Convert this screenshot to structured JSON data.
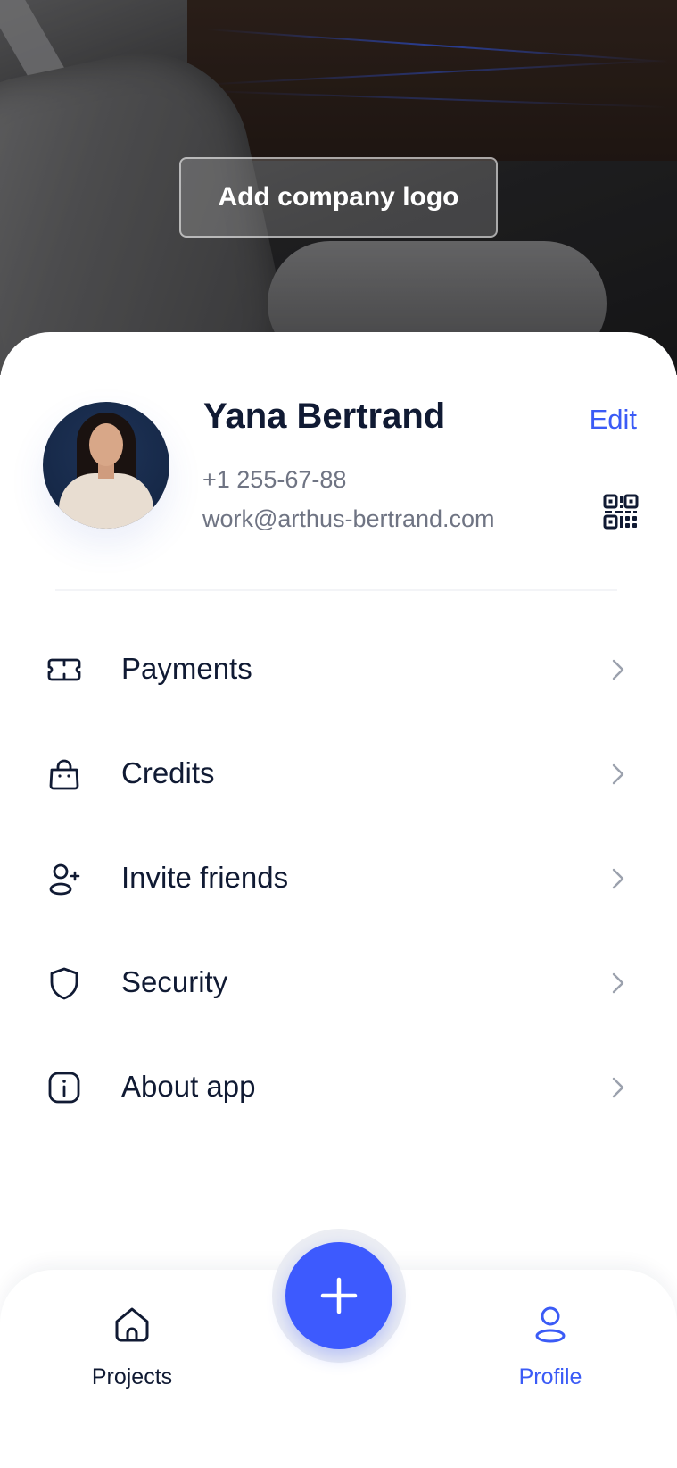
{
  "cover": {
    "add_logo_label": "Add company logo"
  },
  "profile": {
    "name": "Yana Bertrand",
    "edit_label": "Edit",
    "phone": "+1 255-67-88",
    "email": "work@arthus-bertrand.com"
  },
  "menu": {
    "items": [
      {
        "label": "Payments",
        "icon": "ticket-icon"
      },
      {
        "label": "Credits",
        "icon": "bag-icon"
      },
      {
        "label": "Invite friends",
        "icon": "user-plus-icon"
      },
      {
        "label": "Security",
        "icon": "shield-icon"
      },
      {
        "label": "About app",
        "icon": "info-icon"
      }
    ]
  },
  "tabbar": {
    "projects_label": "Projects",
    "profile_label": "Profile",
    "active_tab": "Profile"
  },
  "colors": {
    "accent": "#3b5bf6",
    "fab": "#3d5afe",
    "text": "#101a33",
    "secondary_text": "#6f7483"
  }
}
